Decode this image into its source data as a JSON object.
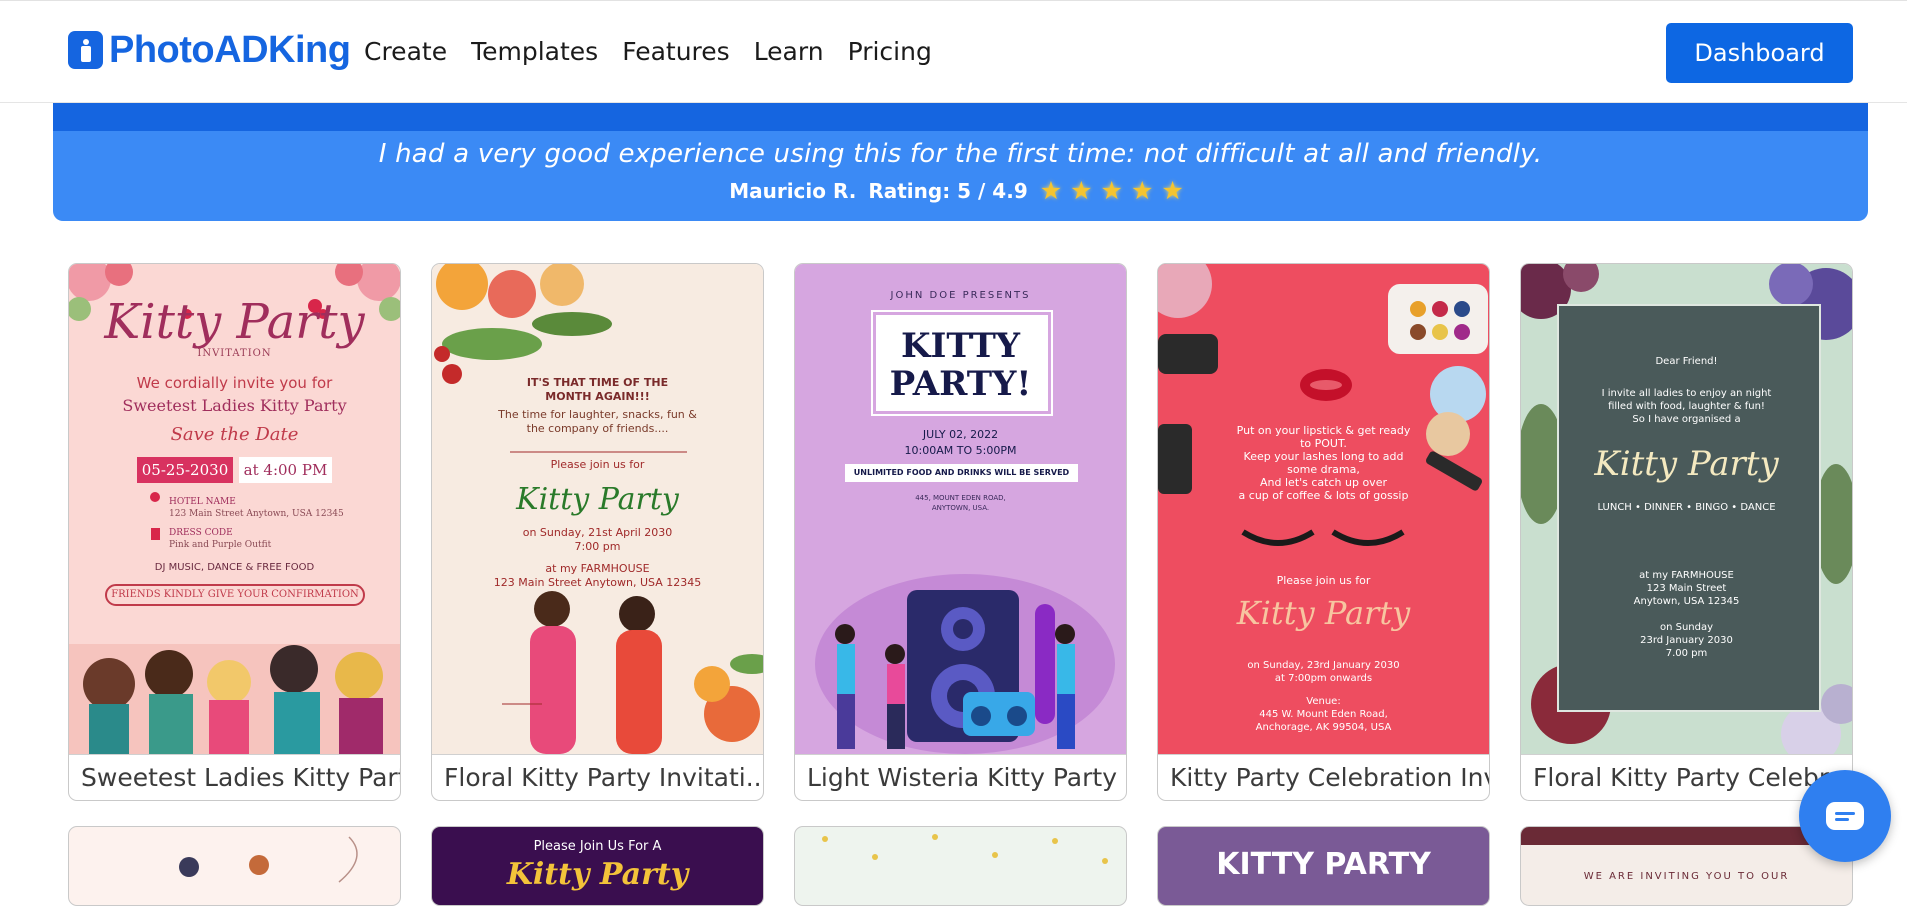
{
  "header": {
    "logo": "PhotoADKing",
    "nav": [
      "Create",
      "Templates",
      "Features",
      "Learn",
      "Pricing"
    ],
    "dashboard_label": "Dashboard"
  },
  "testimonial": {
    "quote": "I had a very good experience using this for the first time: not difficult at all and friendly.",
    "author": "Mauricio R.",
    "rating_text": "Rating: 5 / 4.9",
    "stars": "★★★★★"
  },
  "cards": [
    {
      "caption": "Sweetest Ladies Kitty Party",
      "art": {
        "title": "Kitty Party",
        "sub": "INVITATION",
        "l1": "We cordially invite you for",
        "l2": "Sweetest Ladies Kitty Party",
        "l3": "Save the Date",
        "date": "05-25-2030",
        "time": "at 4:00 PM",
        "h1": "HOTEL NAME",
        "h2": "123 Main Street Anytown, USA 12345",
        "h3": "DRESS CODE",
        "h4": "Pink and Purple Outfit",
        "l4": "DJ MUSIC, DANCE & FREE FOOD",
        "pill": "FRIENDS KINDLY GIVE YOUR CONFIRMATION"
      }
    },
    {
      "caption": "Floral Kitty Party Invitati...",
      "art": {
        "l1": "IT'S THAT TIME OF THE",
        "l1b": "MONTH AGAIN!!!",
        "l2": "The time for laughter, snacks, fun &",
        "l2b": "the company of friends....",
        "l3": "Please join us for",
        "title": "Kitty Party",
        "l4": "on Sunday, 21st April 2030",
        "l5": "7:00 pm",
        "l6": "at my FARMHOUSE",
        "l7": "123 Main Street Anytown, USA 12345"
      }
    },
    {
      "caption": "Light Wisteria Kitty Party I",
      "art": {
        "pre": "JOHN DOE PRESENTS",
        "title1": "KITTY",
        "title2": "PARTY!",
        "d1": "JULY 02, 2022",
        "d2": "10:00AM TO 5:00PM",
        "bar": "UNLIMITED FOOD AND DRINKS WILL BE SERVED",
        "ad1": "445, MOUNT EDEN ROAD,",
        "ad2": "ANYTOWN, USA."
      }
    },
    {
      "caption": "Kitty Party Celebration Inv",
      "art": {
        "l1": "Put on your lipstick & get ready",
        "l2": "to POUT.",
        "l3": "Keep your lashes long to add",
        "l4": "some drama,",
        "l5": "And let's catch up over",
        "l6": "a cup of coffee & lots of gossip",
        "join": "Please join us for",
        "title": "Kitty Party",
        "w1": "on Sunday, 23rd January 2030",
        "w2": "at 7:00pm onwards",
        "v1": "Venue:",
        "v2": "445 W. Mount Eden Road,",
        "v3": "Anchorage, AK 99504, USA"
      }
    },
    {
      "caption": "Floral Kitty Party Celebra",
      "art": {
        "l1": "Dear Friend!",
        "l2": "I invite all ladies to enjoy an night",
        "l3": "filled with food, laughter & fun!",
        "l4": "So I have organised a",
        "title": "Kitty Party",
        "l5": "LUNCH • DINNER • BINGO • DANCE",
        "l6": "at my FARMHOUSE",
        "l7": "123 Main Street",
        "l8": "Anytown, USA 12345",
        "l9": "on Sunday",
        "l10": "23rd January 2030",
        "l11": "7.00 pm"
      }
    }
  ],
  "row2": {
    "r2_top": "Please Join Us For A",
    "r2_title": "Kitty Party",
    "r4_title": "KITTY PARTY",
    "r5_text": "WE ARE INVITING YOU TO OUR"
  }
}
